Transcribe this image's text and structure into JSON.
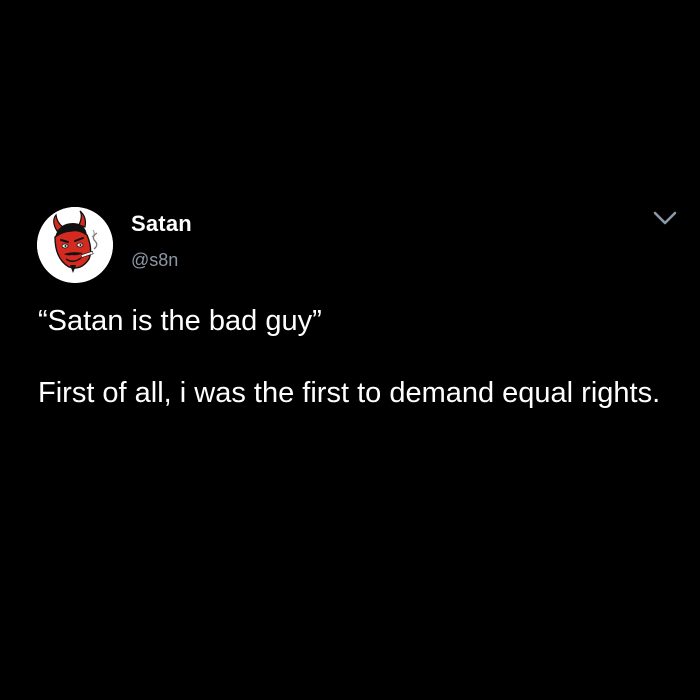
{
  "tweet": {
    "author": {
      "display_name": "Satan",
      "handle": "@s8n",
      "avatar_icon": "devil-avatar-icon"
    },
    "menu_icon": "chevron-down-icon",
    "text": {
      "line1": "“Satan is the bad guy”",
      "line2": "First of all, i was the first to demand equal rights."
    }
  },
  "colors": {
    "background": "#000000",
    "text_primary": "#ffffff",
    "text_secondary": "#8b98a5",
    "avatar_red": "#d42a1f"
  }
}
